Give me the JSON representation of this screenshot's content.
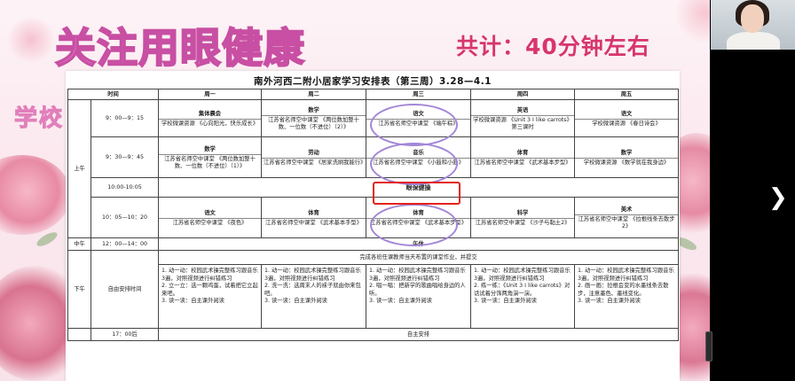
{
  "slide": {
    "main_title": "关注用眼健康",
    "total_time": "共计：40分钟左右",
    "school_label": "学校"
  },
  "sheet": {
    "title": "南外河西二附小居家学习安排表（第三周）3.28—4.1",
    "headers": [
      "时间",
      "周一",
      "周二",
      "周三",
      "周四",
      "周五"
    ],
    "morning_label": "上午",
    "noon_label": "中午",
    "afternoon_label": "下午",
    "rows": {
      "r1": {
        "time": "9：00—9：15",
        "cells": [
          {
            "subject": "集体晨会",
            "content": "学校微课资源 《心向阳光，快乐成长》"
          },
          {
            "subject": "数学",
            "content": "江苏省名师空中课堂 《两位数加整十数、一位数（不进位）（2）》"
          },
          {
            "subject": "语文",
            "content": "江苏省名师空中课堂 《端午粽》"
          },
          {
            "subject": "英语",
            "content": "学校微课资源 《Unit 3 I like carrots》第三课时"
          },
          {
            "subject": "语文",
            "content": "学校微课资源 《春日诗会》"
          }
        ]
      },
      "r2": {
        "time": "9：30—9：45",
        "cells": [
          {
            "subject": "数学",
            "content": "江苏省名师空中课堂 《两位数加整十数、一位数（不进位）（1）》"
          },
          {
            "subject": "劳动",
            "content": "江苏省名师空中课堂 《居家洗刷我能行》"
          },
          {
            "subject": "音乐",
            "content": "江苏省名师空中课堂 《小鼓和小鼓》"
          },
          {
            "subject": "体育",
            "content": "江苏省名师空中课堂 《武术基本步型》"
          },
          {
            "subject": "数学",
            "content": "学校微课资源 《数学就在我身边》"
          }
        ]
      },
      "eye": {
        "time": "10:00-10:05",
        "label": "眼保健操"
      },
      "r3": {
        "time": "10：05—10：20",
        "cells": [
          {
            "subject": "语文",
            "content": "江苏省名师空中课堂 《夜色》"
          },
          {
            "subject": "体育",
            "content": "江苏省名师空中课堂 《武术基本手型》"
          },
          {
            "subject": "体育",
            "content": "江苏省名师空中课堂 《武术基本步型》"
          },
          {
            "subject": "科学",
            "content": "江苏省名师空中课堂 《沙子与黏土2》"
          },
          {
            "subject": "美术",
            "content": "江苏省名师空中课堂 《拉根线条去散步2》"
          }
        ]
      },
      "noon": {
        "time": "12：00—14：00",
        "label": "午休"
      },
      "afternoon": {
        "time": "自由安排时间",
        "note": "完成各班任课教师当天布置的课堂作业，并提交",
        "cells": [
          {
            "items": [
              "1. 动一动：校园武术操完整练习跟音乐3遍，对照视频进行纠错练习",
              "2. 立一立：选一颗鸡蛋，试着把它立起来吧。",
              "3. 读一读：自主课外阅读"
            ]
          },
          {
            "items": [
              "1. 动一动：校园武术操完整练习跟音乐3遍，对照视频进行纠错练习",
              "2. 洗一洗：选周末人的袜子就由你来包吧。",
              "3. 读一读：自主课外阅读"
            ]
          },
          {
            "items": [
              "1. 动一动：校园武术操完整练习跟音乐3遍，对照视频进行纠错练习",
              "2. 唱一唱：把新学的歌曲唱给身边的人听。",
              "3. 读一读：自主课外阅读"
            ]
          },
          {
            "items": [
              "1. 动一动：校园武术操完整练习跟音乐3遍，对照视频进行纠错练习",
              "2. 练一练：《Unit 3 I like carrots》对话试着分饰两角演一演。",
              "3. 读一读：自主课外阅读"
            ]
          },
          {
            "items": [
              "1. 动一动：校园武术操完整练习跟音乐3遍，对照视频进行纠错练习",
              "2. 画一画：拉根会变的水墨线条去散步，注意墨色、墨线变化。",
              "3. 读一读：自主课外阅读"
            ]
          }
        ]
      },
      "evening": {
        "time": "17：00后",
        "label": "自主安排"
      }
    }
  },
  "colors": {
    "title_pink": "#e889c7",
    "total_red": "#d7356e",
    "oval_purple": "#a286d6",
    "box_red": "#e3221d"
  },
  "icons": {
    "next": "chevron-right-icon"
  }
}
